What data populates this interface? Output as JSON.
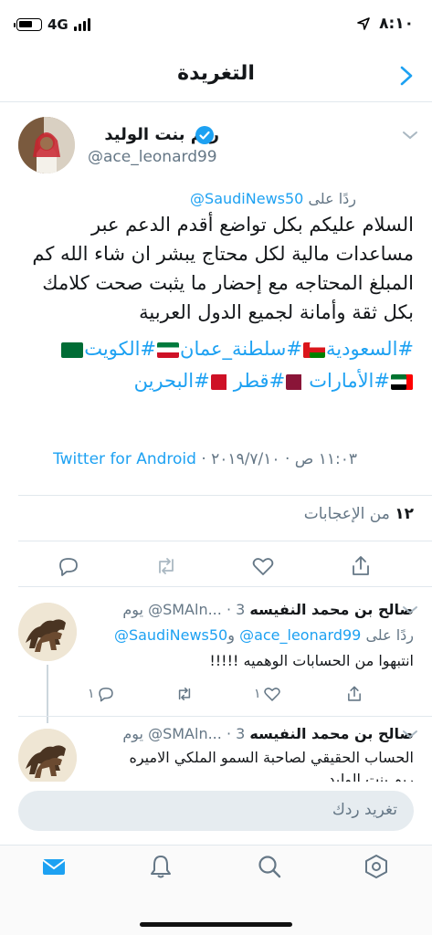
{
  "status_bar": {
    "network": "4G",
    "time": "٨:١٠"
  },
  "nav": {
    "title": "التغريدة"
  },
  "tweet": {
    "author_name": "ريم بنت الوليد",
    "author_handle": "@ace_leonard99",
    "reply_to_prefix": "ردًا على",
    "reply_to_handle": "@SaudiNews50",
    "text": "السلام عليكم بكل تواضع أقدم الدعم عبر مساعدات مالية لكل محتاج يبشر ان شاء الله كم المبلغ المحتاجه مع إحضار ما يثبت صحت كلامك بكل ثقة وأمانة لجميع الدول العربية",
    "hashtags": [
      "#السعودية",
      "#سلطنة_عمان",
      "#الكويت",
      "#الأمارات",
      "#قطر",
      "#البحرين"
    ],
    "time": "١١:٠٣ ص",
    "separator": "·",
    "date": "٢٠١٩/٧/١٠",
    "source": "Twitter for Android",
    "likes_count": "١٢",
    "likes_label": "من الإعجابات"
  },
  "replies": [
    {
      "name": "صالح بن محمد النفيسه",
      "handle": "@SMAln...",
      "age": "3 يوم",
      "reply_prefix": "ردًا على",
      "mention1": "@ace_leonard99",
      "connector": "و",
      "mention2": "@SaudiNews50",
      "text": "انتبهوا من الحسابات الوهميه !!!!!",
      "replies_count": "١",
      "retweets_count": "",
      "likes_count": "١",
      "more_icon": "share-icon"
    },
    {
      "name": "صالح بن محمد النفيسه",
      "handle": "@SMAln...",
      "age": "3 يوم",
      "text_line1": "الحساب الحقيقي لصاحبة السمو الملكي الاميره",
      "text_line2": "ريم بنت الوليد"
    }
  ],
  "composer": {
    "placeholder": "تغريد ردك"
  },
  "colors": {
    "accent": "#1da1f2",
    "secondary_text": "#657786",
    "border": "#e1e8ed"
  },
  "icons": {
    "tab_home": "mail-icon",
    "tab_notifications": "bell-icon",
    "tab_search": "search-icon",
    "tab_profile": "settings-hexagon-icon"
  }
}
